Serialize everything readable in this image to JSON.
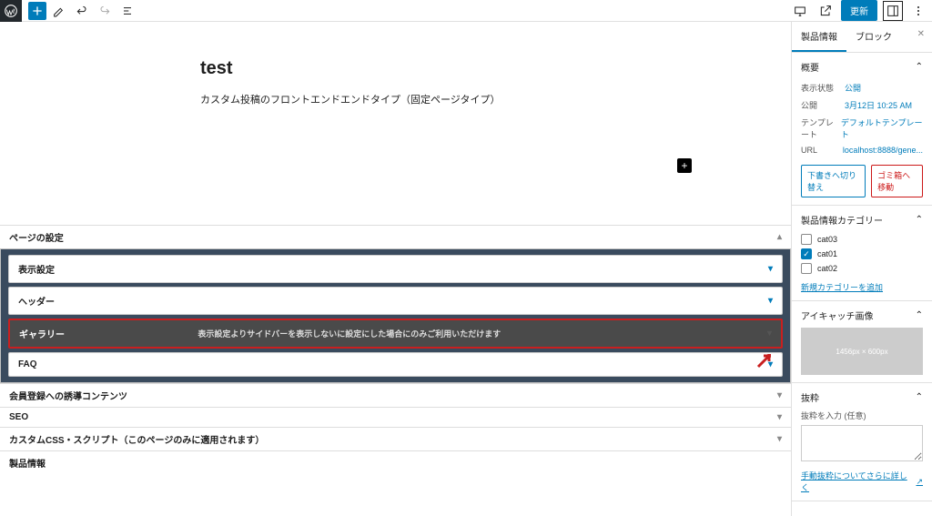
{
  "toolbar": {
    "update_label": "更新"
  },
  "post": {
    "title": "test",
    "body": "カスタム投稿のフロントエンドエンドタイプ（固定ページタイプ）"
  },
  "metabox": {
    "page_settings": "ページの設定",
    "display_settings": "表示設定",
    "header": "ヘッダー",
    "gallery_label": "ギャラリー",
    "gallery_hint": "表示設定よりサイドバーを表示しないに設定にした場合にのみご利用いただけます",
    "faq": "FAQ",
    "member_cta": "会員登録への誘導コンテンツ",
    "seo": "SEO",
    "custom_css": "カスタムCSS・スクリプト（このページのみに適用されます）",
    "product_info": "製品情報"
  },
  "sidebar": {
    "tabs": {
      "product": "製品情報",
      "block": "ブロック"
    },
    "summary": {
      "title": "概要",
      "status_label": "表示状態",
      "status_value": "公開",
      "publish_label": "公開",
      "publish_value": "3月12日 10:25 AM",
      "template_label": "テンプレート",
      "template_value": "デフォルトテンプレート",
      "url_label": "URL",
      "url_value": "localhost:8888/gene...",
      "switch_draft": "下書きへ切り替え",
      "trash": "ゴミ箱へ移動"
    },
    "categories": {
      "title": "製品情報カテゴリー",
      "items": [
        "cat03",
        "cat01",
        "cat02"
      ],
      "add_new": "新規カテゴリーを追加"
    },
    "thumbnail": {
      "title": "アイキャッチ画像",
      "placeholder": "1456px × 600px"
    },
    "excerpt": {
      "title": "抜粋",
      "label": "抜粋を入力 (任意)",
      "help_link": "手動抜粋についてさらに詳しく"
    }
  }
}
